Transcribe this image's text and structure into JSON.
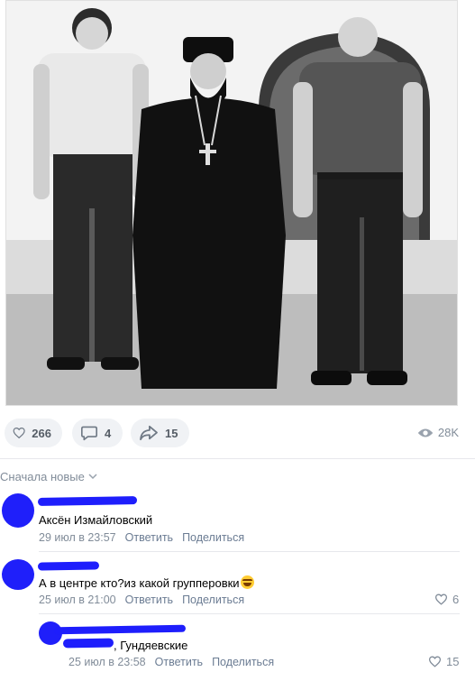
{
  "post": {
    "likes": "266",
    "comments": "4",
    "shares": "15",
    "views": "28K"
  },
  "sort_label": "Сначала новые",
  "comments": [
    {
      "text": "Аксён Измайловский",
      "date": "29 июл в 23:57",
      "reply": "Ответить",
      "share": "Поделиться",
      "likes": ""
    },
    {
      "text": "А в центре кто?из какой групперовки",
      "date": "25 июл в 21:00",
      "reply": "Ответить",
      "share": "Поделиться",
      "likes": "6"
    },
    {
      "text": ", Гундяевские",
      "date": "25 июл в 23:58",
      "reply": "Ответить",
      "share": "Поделиться",
      "likes": "15"
    }
  ],
  "colors": {
    "pill_bg": "#f0f2f5",
    "meta_gray": "#818c99",
    "scribble_blue": "#1e1efc"
  },
  "icons": [
    "heart-icon",
    "comment-icon",
    "share-icon",
    "eye-icon",
    "chevron-down-icon",
    "laughing-emoji-icon"
  ]
}
